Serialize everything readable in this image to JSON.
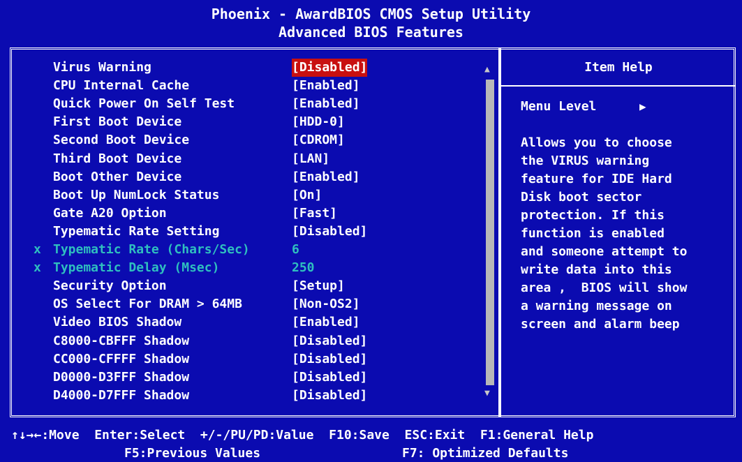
{
  "header": {
    "title": "Phoenix - AwardBIOS CMOS Setup Utility",
    "subtitle": "Advanced BIOS Features"
  },
  "settings": [
    {
      "label": "Virus Warning",
      "value": "[Disabled]",
      "selected": true,
      "disabled": false
    },
    {
      "label": "CPU Internal Cache",
      "value": "[Enabled]",
      "selected": false,
      "disabled": false
    },
    {
      "label": "Quick Power On Self Test",
      "value": "[Enabled]",
      "selected": false,
      "disabled": false
    },
    {
      "label": "First Boot Device",
      "value": "[HDD-0]",
      "selected": false,
      "disabled": false
    },
    {
      "label": "Second Boot Device",
      "value": "[CDROM]",
      "selected": false,
      "disabled": false
    },
    {
      "label": "Third Boot Device",
      "value": "[LAN]",
      "selected": false,
      "disabled": false
    },
    {
      "label": "Boot Other Device",
      "value": "[Enabled]",
      "selected": false,
      "disabled": false
    },
    {
      "label": "Boot Up NumLock Status",
      "value": "[On]",
      "selected": false,
      "disabled": false
    },
    {
      "label": "Gate A20 Option",
      "value": "[Fast]",
      "selected": false,
      "disabled": false
    },
    {
      "label": "Typematic Rate Setting",
      "value": "[Disabled]",
      "selected": false,
      "disabled": false
    },
    {
      "label": "Typematic Rate (Chars/Sec)",
      "value": "6",
      "selected": false,
      "disabled": true
    },
    {
      "label": "Typematic Delay (Msec)",
      "value": "250",
      "selected": false,
      "disabled": true
    },
    {
      "label": "Security Option",
      "value": "[Setup]",
      "selected": false,
      "disabled": false
    },
    {
      "label": "OS Select For DRAM > 64MB",
      "value": "[Non-OS2]",
      "selected": false,
      "disabled": false
    },
    {
      "label": "Video BIOS Shadow",
      "value": "[Enabled]",
      "selected": false,
      "disabled": false
    },
    {
      "label": "C8000-CBFFF Shadow",
      "value": "[Disabled]",
      "selected": false,
      "disabled": false
    },
    {
      "label": "CC000-CFFFF Shadow",
      "value": "[Disabled]",
      "selected": false,
      "disabled": false
    },
    {
      "label": "D0000-D3FFF Shadow",
      "value": "[Disabled]",
      "selected": false,
      "disabled": false
    },
    {
      "label": "D4000-D7FFF Shadow",
      "value": "[Disabled]",
      "selected": false,
      "disabled": false
    }
  ],
  "disabled_marker": "x",
  "scroll": {
    "up_icon": "triangle-up",
    "down_icon": "triangle-down",
    "up_glyph": "▲",
    "down_glyph": "▼"
  },
  "help": {
    "title": "Item Help",
    "menu_level": "Menu Level",
    "menu_arrow": "▶",
    "lines": [
      "Allows you to choose",
      "the VIRUS warning",
      "feature for IDE Hard",
      "Disk boot sector",
      "protection. If this",
      "function is enabled",
      "and someone attempt to",
      "write data into this",
      "area ,  BIOS will show",
      "a warning message on",
      "screen and alarm beep"
    ]
  },
  "footer": {
    "line1": "↑↓→←:Move  Enter:Select  +/-/PU/PD:Value  F10:Save  ESC:Exit  F1:General Help",
    "line2a": "F5:Previous Values",
    "line2b": "F7: Optimized Defaults"
  },
  "colors": {
    "background": "#0b0bb0",
    "text": "#ffffff",
    "disabled_text": "#2fbfbf",
    "highlight": "#c81010",
    "scrollbar": "#b8b8b8"
  }
}
